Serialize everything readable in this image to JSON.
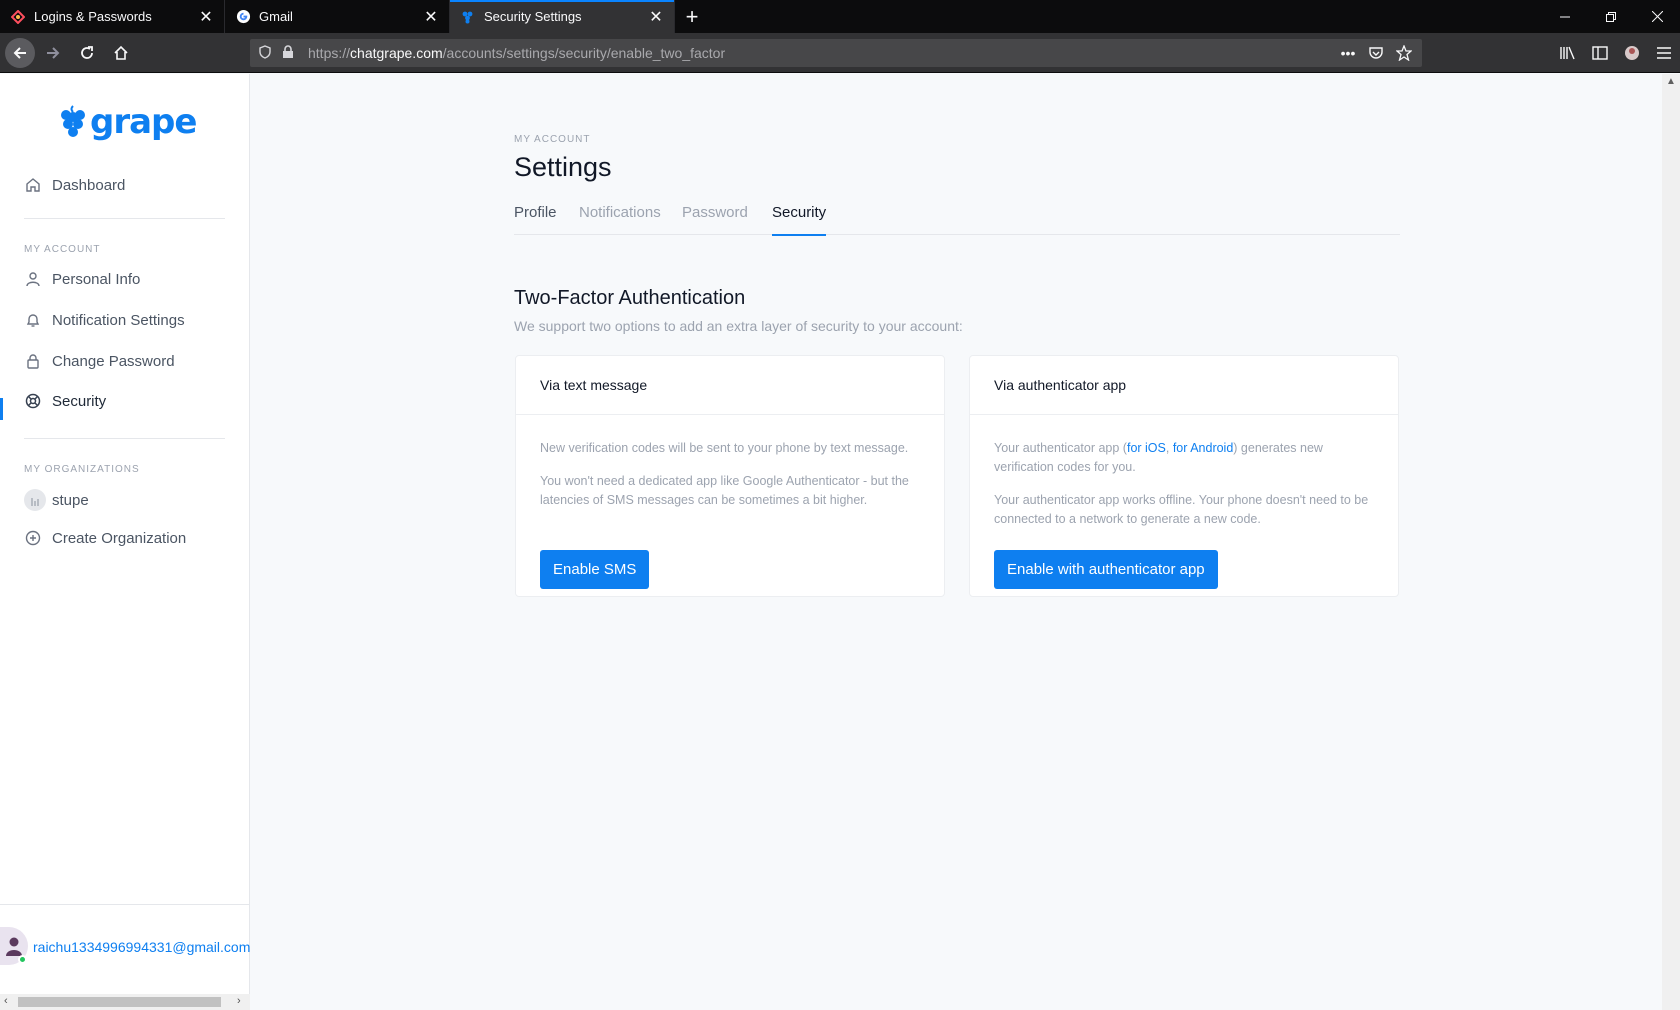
{
  "browser": {
    "tabs": [
      {
        "title": "Logins & Passwords",
        "icon": "lockwise-icon",
        "active": false
      },
      {
        "title": "Gmail",
        "icon": "google-icon",
        "active": false
      },
      {
        "title": "Security Settings",
        "icon": "grape-icon",
        "active": true
      }
    ],
    "url_prefix": "https://",
    "url_host": "chatgrape.com",
    "url_path": "/accounts/settings/security/enable_two_factor"
  },
  "sidebar": {
    "logo_text": "grape",
    "dashboard": "Dashboard",
    "my_account_label": "MY ACCOUNT",
    "account_items": [
      {
        "label": "Personal Info",
        "icon": "user-icon"
      },
      {
        "label": "Notification Settings",
        "icon": "bell-icon"
      },
      {
        "label": "Change Password",
        "icon": "lock-icon"
      },
      {
        "label": "Security",
        "icon": "lifebuoy-icon",
        "active": true
      }
    ],
    "my_orgs_label": "MY ORGANIZATIONS",
    "org_name": "stupe",
    "create_org": "Create Organization",
    "user_email": "raichu1334996994331@gmail.com"
  },
  "main": {
    "eyebrow": "MY ACCOUNT",
    "title": "Settings",
    "tabs": [
      "Profile",
      "Notifications",
      "Password",
      "Security"
    ],
    "active_tab": "Security",
    "section_title": "Two-Factor Authentication",
    "section_subtitle": "We support two options to add an extra layer of security to your account:",
    "sms_card": {
      "title": "Via text message",
      "p1": "New verification codes will be sent to your phone by text message.",
      "p2": "You won't need a dedicated app like Google Authenticator - but the latencies of SMS messages can be sometimes a bit higher.",
      "button": "Enable SMS"
    },
    "app_card": {
      "title": "Via authenticator app",
      "p1_pre": "Your authenticator app (",
      "link_ios": "for iOS",
      "p1_sep": ", ",
      "link_android": "for Android",
      "p1_post": ") generates new verification codes for you.",
      "p2": "Your authenticator app works offline. Your phone doesn't need to be connected to a network to generate a new code.",
      "button": "Enable with authenticator app"
    }
  },
  "colors": {
    "brand": "#0e7ff0",
    "online": "#22c55e"
  }
}
